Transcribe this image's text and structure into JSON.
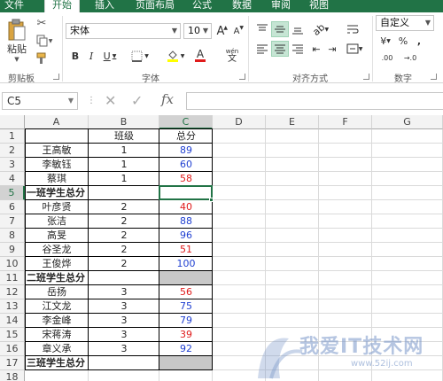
{
  "ribbon_tabs": [
    {
      "label": "文件",
      "active": false
    },
    {
      "label": "开始",
      "active": true
    },
    {
      "label": "插入",
      "active": false
    },
    {
      "label": "页面布局",
      "active": false
    },
    {
      "label": "公式",
      "active": false
    },
    {
      "label": "数据",
      "active": false
    },
    {
      "label": "审阅",
      "active": false
    },
    {
      "label": "视图",
      "active": false
    }
  ],
  "clipboard": {
    "paste_label": "粘贴",
    "group_label": "剪贴板"
  },
  "font": {
    "name": "宋体",
    "size": "10",
    "bold": "B",
    "italic": "I",
    "underline": "U",
    "grow": "A",
    "shrink": "A",
    "group_label": "字体",
    "wen": "wén"
  },
  "alignment": {
    "group_label": "对齐方式"
  },
  "number": {
    "format": "自定义",
    "group_label": "数字",
    "currency": "¥",
    "percent": "%",
    "comma": ",",
    "inc": ".00",
    "dec": "→.0"
  },
  "formula_bar": {
    "name_box": "C5",
    "formula": ""
  },
  "columns": [
    "A",
    "B",
    "C",
    "D",
    "E",
    "F",
    "G"
  ],
  "active_column": "C",
  "rows": [
    "1",
    "2",
    "3",
    "4",
    "5",
    "6",
    "7",
    "8",
    "9",
    "10",
    "11",
    "12",
    "13",
    "14",
    "15",
    "16",
    "17",
    "18",
    "19"
  ],
  "active_row": "5",
  "header": {
    "a": "",
    "b": "班级",
    "c": "总分"
  },
  "table": [
    {
      "name": "王高敏",
      "class": "1",
      "score": "89",
      "color": "blue"
    },
    {
      "name": "李敏钰",
      "class": "1",
      "score": "60",
      "color": "blue"
    },
    {
      "name": "蔡琪",
      "class": "1",
      "score": "58",
      "color": "red"
    },
    {
      "name": "一班学生总分",
      "class": "",
      "score": "",
      "subtotal": true
    },
    {
      "name": "叶彦贤",
      "class": "2",
      "score": "40",
      "color": "red"
    },
    {
      "name": "张洁",
      "class": "2",
      "score": "88",
      "color": "blue"
    },
    {
      "name": "高旻",
      "class": "2",
      "score": "96",
      "color": "blue"
    },
    {
      "name": "谷圣龙",
      "class": "2",
      "score": "51",
      "color": "red"
    },
    {
      "name": "王俊烨",
      "class": "2",
      "score": "100",
      "color": "blue"
    },
    {
      "name": "二班学生总分",
      "class": "",
      "score": "",
      "subtotal": true
    },
    {
      "name": "岳扬",
      "class": "3",
      "score": "56",
      "color": "red"
    },
    {
      "name": "江文龙",
      "class": "3",
      "score": "75",
      "color": "blue"
    },
    {
      "name": "李金峰",
      "class": "3",
      "score": "79",
      "color": "blue"
    },
    {
      "name": "宋蒋涛",
      "class": "3",
      "score": "39",
      "color": "red"
    },
    {
      "name": "章义承",
      "class": "3",
      "score": "92",
      "color": "blue"
    },
    {
      "name": "三班学生总分",
      "class": "",
      "score": "",
      "subtotal": true
    }
  ],
  "colors": {
    "excel_green": "#217346",
    "score_blue": "#1f3fd1",
    "score_red": "#e01b1b",
    "subtotal_gray": "#c8c8c8"
  },
  "watermark": {
    "text": "我爱IT技术网",
    "url": "www.52ij.com"
  }
}
